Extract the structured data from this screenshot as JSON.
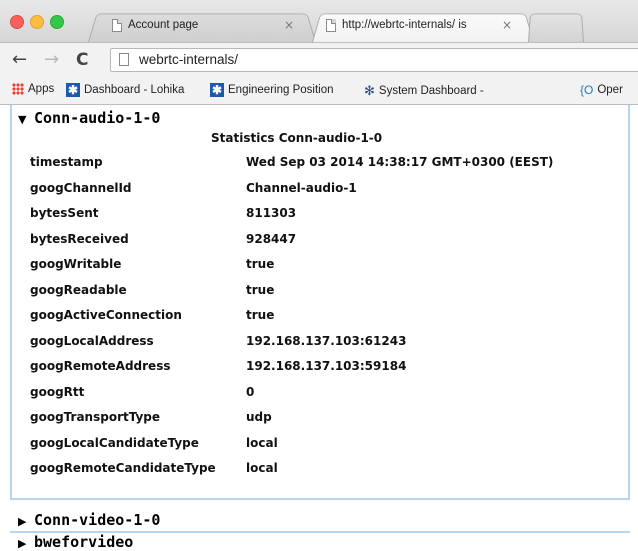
{
  "browser": {
    "tabs": [
      {
        "title": "Account page",
        "close": "×"
      },
      {
        "title": "http://webrtc-internals/ is",
        "close": "×"
      }
    ],
    "address": "webrtc-internals/",
    "nav": {
      "back": "←",
      "forward": "→",
      "reload": "C"
    },
    "bookmarks": [
      {
        "label": "Apps",
        "icon": "apps-icon"
      },
      {
        "label": "Dashboard - Lohika",
        "icon": "star-icon"
      },
      {
        "label": "Engineering Position",
        "icon": "star-icon"
      },
      {
        "label": "System Dashboard -",
        "icon": "system-icon"
      },
      {
        "label": "Oper",
        "icon": "brace-icon"
      }
    ]
  },
  "page": {
    "section_open": {
      "caret": "▼",
      "title": "Conn-audio-1-0"
    },
    "stats_title": "Statistics Conn-audio-1-0",
    "rows": [
      {
        "key": "timestamp",
        "value": "Wed Sep 03 2014 14:38:17 GMT+0300 (EEST)"
      },
      {
        "key": "googChannelId",
        "value": "Channel-audio-1"
      },
      {
        "key": "bytesSent",
        "value": "811303"
      },
      {
        "key": "bytesReceived",
        "value": "928447"
      },
      {
        "key": "googWritable",
        "value": "true"
      },
      {
        "key": "googReadable",
        "value": "true"
      },
      {
        "key": "googActiveConnection",
        "value": "true"
      },
      {
        "key": "googLocalAddress",
        "value": "192.168.137.103:61243"
      },
      {
        "key": "googRemoteAddress",
        "value": "192.168.137.103:59184"
      },
      {
        "key": "googRtt",
        "value": "0"
      },
      {
        "key": "googTransportType",
        "value": "udp"
      },
      {
        "key": "googLocalCandidateType",
        "value": "local"
      },
      {
        "key": "googRemoteCandidateType",
        "value": "local"
      }
    ],
    "section_closed": {
      "caret": "▶",
      "title": "Conn-video-1-0"
    },
    "section_cut": {
      "caret": "▶",
      "title": "bweforvideo"
    }
  }
}
